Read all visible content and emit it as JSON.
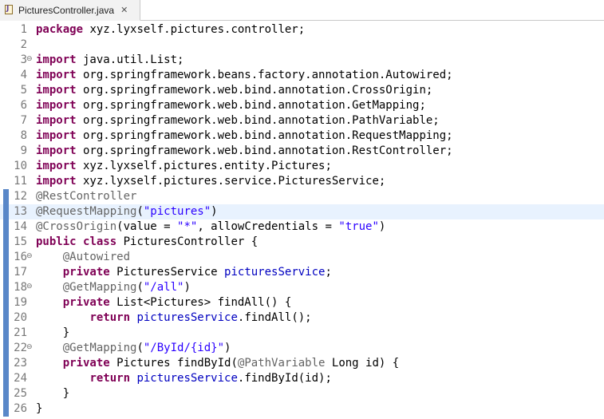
{
  "tab": {
    "title": "PicturesController.java",
    "close_glyph": "✕"
  },
  "lines": [
    {
      "n": "1",
      "fold": false,
      "tokens": [
        {
          "t": "package",
          "c": "kw"
        },
        {
          "t": " xyz.lyxself.pictures.controller;",
          "c": ""
        }
      ]
    },
    {
      "n": "2",
      "fold": false,
      "tokens": []
    },
    {
      "n": "3",
      "fold": true,
      "tokens": [
        {
          "t": "import",
          "c": "kw"
        },
        {
          "t": " java.util.List;",
          "c": ""
        }
      ]
    },
    {
      "n": "4",
      "fold": false,
      "tokens": [
        {
          "t": "import",
          "c": "kw"
        },
        {
          "t": " org.springframework.beans.factory.annotation.Autowired;",
          "c": ""
        }
      ]
    },
    {
      "n": "5",
      "fold": false,
      "tokens": [
        {
          "t": "import",
          "c": "kw"
        },
        {
          "t": " org.springframework.web.bind.annotation.CrossOrigin;",
          "c": ""
        }
      ]
    },
    {
      "n": "6",
      "fold": false,
      "tokens": [
        {
          "t": "import",
          "c": "kw"
        },
        {
          "t": " org.springframework.web.bind.annotation.GetMapping;",
          "c": ""
        }
      ]
    },
    {
      "n": "7",
      "fold": false,
      "tokens": [
        {
          "t": "import",
          "c": "kw"
        },
        {
          "t": " org.springframework.web.bind.annotation.PathVariable;",
          "c": ""
        }
      ]
    },
    {
      "n": "8",
      "fold": false,
      "tokens": [
        {
          "t": "import",
          "c": "kw"
        },
        {
          "t": " org.springframework.web.bind.annotation.RequestMapping;",
          "c": ""
        }
      ]
    },
    {
      "n": "9",
      "fold": false,
      "tokens": [
        {
          "t": "import",
          "c": "kw"
        },
        {
          "t": " org.springframework.web.bind.annotation.RestController;",
          "c": ""
        }
      ]
    },
    {
      "n": "10",
      "fold": false,
      "tokens": [
        {
          "t": "import",
          "c": "kw"
        },
        {
          "t": " xyz.lyxself.pictures.entity.Pictures;",
          "c": ""
        }
      ]
    },
    {
      "n": "11",
      "fold": false,
      "tokens": [
        {
          "t": "import",
          "c": "kw"
        },
        {
          "t": " xyz.lyxself.pictures.service.PicturesService;",
          "c": ""
        }
      ]
    },
    {
      "n": "12",
      "fold": false,
      "tokens": [
        {
          "t": "@RestController",
          "c": "ann"
        }
      ]
    },
    {
      "n": "13",
      "fold": false,
      "current": true,
      "tokens": [
        {
          "t": "@RequestMapping",
          "c": "ann"
        },
        {
          "t": "(",
          "c": ""
        },
        {
          "t": "\"pictures\"",
          "c": "str"
        },
        {
          "t": ")",
          "c": ""
        }
      ]
    },
    {
      "n": "14",
      "fold": false,
      "tokens": [
        {
          "t": "@CrossOrigin",
          "c": "ann"
        },
        {
          "t": "(value = ",
          "c": ""
        },
        {
          "t": "\"*\"",
          "c": "str"
        },
        {
          "t": ", allowCredentials = ",
          "c": ""
        },
        {
          "t": "\"true\"",
          "c": "str"
        },
        {
          "t": ")",
          "c": ""
        }
      ]
    },
    {
      "n": "15",
      "fold": false,
      "tokens": [
        {
          "t": "public",
          "c": "kw"
        },
        {
          "t": " ",
          "c": ""
        },
        {
          "t": "class",
          "c": "kw"
        },
        {
          "t": " PicturesController {",
          "c": ""
        }
      ]
    },
    {
      "n": "16",
      "fold": true,
      "tokens": [
        {
          "t": "    ",
          "c": ""
        },
        {
          "t": "@Autowired",
          "c": "ann"
        }
      ]
    },
    {
      "n": "17",
      "fold": false,
      "tokens": [
        {
          "t": "    ",
          "c": ""
        },
        {
          "t": "private",
          "c": "kw"
        },
        {
          "t": " PicturesService ",
          "c": ""
        },
        {
          "t": "picturesService",
          "c": "fld"
        },
        {
          "t": ";",
          "c": ""
        }
      ]
    },
    {
      "n": "18",
      "fold": true,
      "tokens": [
        {
          "t": "    ",
          "c": ""
        },
        {
          "t": "@GetMapping",
          "c": "ann"
        },
        {
          "t": "(",
          "c": ""
        },
        {
          "t": "\"/all\"",
          "c": "str"
        },
        {
          "t": ")",
          "c": ""
        }
      ]
    },
    {
      "n": "19",
      "fold": false,
      "tokens": [
        {
          "t": "    ",
          "c": ""
        },
        {
          "t": "private",
          "c": "kw"
        },
        {
          "t": " List<Pictures> findAll() {",
          "c": ""
        }
      ]
    },
    {
      "n": "20",
      "fold": false,
      "tokens": [
        {
          "t": "        ",
          "c": ""
        },
        {
          "t": "return",
          "c": "kw"
        },
        {
          "t": " ",
          "c": ""
        },
        {
          "t": "picturesService",
          "c": "fld"
        },
        {
          "t": ".findAll();",
          "c": ""
        }
      ]
    },
    {
      "n": "21",
      "fold": false,
      "tokens": [
        {
          "t": "    }",
          "c": ""
        }
      ]
    },
    {
      "n": "22",
      "fold": true,
      "tokens": [
        {
          "t": "    ",
          "c": ""
        },
        {
          "t": "@GetMapping",
          "c": "ann"
        },
        {
          "t": "(",
          "c": ""
        },
        {
          "t": "\"/ById/{id}\"",
          "c": "str"
        },
        {
          "t": ")",
          "c": ""
        }
      ]
    },
    {
      "n": "23",
      "fold": false,
      "tokens": [
        {
          "t": "    ",
          "c": ""
        },
        {
          "t": "private",
          "c": "kw"
        },
        {
          "t": " Pictures findById(",
          "c": ""
        },
        {
          "t": "@PathVariable",
          "c": "ann"
        },
        {
          "t": " Long id) {",
          "c": ""
        }
      ]
    },
    {
      "n": "24",
      "fold": false,
      "tokens": [
        {
          "t": "        ",
          "c": ""
        },
        {
          "t": "return",
          "c": "kw"
        },
        {
          "t": " ",
          "c": ""
        },
        {
          "t": "picturesService",
          "c": "fld"
        },
        {
          "t": ".findById(id);",
          "c": ""
        }
      ]
    },
    {
      "n": "25",
      "fold": false,
      "tokens": [
        {
          "t": "    }",
          "c": ""
        }
      ]
    },
    {
      "n": "26",
      "fold": false,
      "tokens": [
        {
          "t": "}",
          "c": ""
        }
      ]
    }
  ],
  "colors": {
    "keyword": "#7f0055",
    "annotation": "#646464",
    "string": "#2a00ff",
    "field": "#0000c0",
    "current_line": "#e8f2fe",
    "change_marker": "#5987c8"
  },
  "icons": {
    "file_icon": "java-file-icon",
    "fold_icon": "collapse-icon",
    "close_icon": "close-icon"
  }
}
